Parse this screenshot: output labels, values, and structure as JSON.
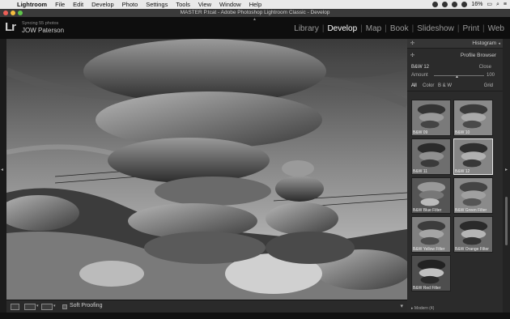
{
  "menubar": {
    "items": [
      "Lightroom",
      "File",
      "Edit",
      "Develop",
      "Photo",
      "Settings",
      "Tools",
      "View",
      "Window",
      "Help"
    ],
    "battery": "16%"
  },
  "window": {
    "title": "MASTER P.tcat - Adobe Photoshop Lightroom Classic - Develop"
  },
  "identity": {
    "logo": "Lr",
    "sync_status": "Syncing 55 photos",
    "owner": "JOW Paterson"
  },
  "modules": [
    "Library",
    "Develop",
    "Map",
    "Book",
    "Slideshow",
    "Print",
    "Web"
  ],
  "active_module": "Develop",
  "right_panel": {
    "histogram_label": "Histogram",
    "profile_browser_label": "Profile Browser",
    "current_profile": "B&W 12",
    "close_label": "Close",
    "amount_label": "Amount",
    "amount_value": "100",
    "amount_fraction": 0.5,
    "filters": [
      "All",
      "Color",
      "B & W"
    ],
    "view_label": "Grid",
    "profiles": [
      {
        "label": "B&W 09",
        "selected": false
      },
      {
        "label": "B&W 10",
        "selected": false
      },
      {
        "label": "B&W 11",
        "selected": false
      },
      {
        "label": "B&W 12",
        "selected": true
      },
      {
        "label": "B&W Blue Filter",
        "selected": false
      },
      {
        "label": "B&W Green Filter",
        "selected": false
      },
      {
        "label": "B&W Yellow Filter",
        "selected": false
      },
      {
        "label": "B&W Orange Filter",
        "selected": false
      },
      {
        "label": "B&W Red Filter",
        "selected": false
      }
    ],
    "next_group": "Modern (4)"
  },
  "toolbar": {
    "soft_proofing_label": "Soft Proofing"
  },
  "colors": {
    "active_module": "#ffffff",
    "inactive_module": "#9a9a9a",
    "panel_bg": "#2b2b2b"
  }
}
